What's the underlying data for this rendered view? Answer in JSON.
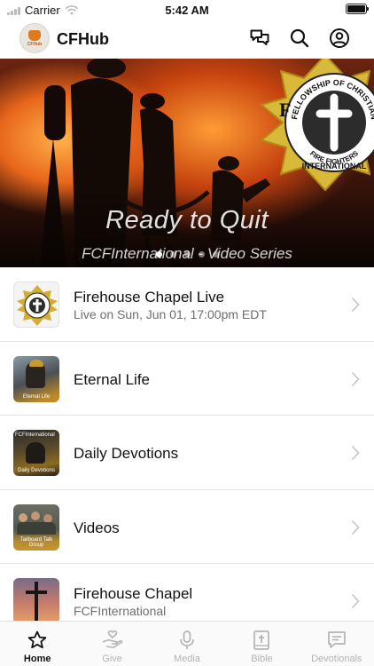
{
  "status_bar": {
    "carrier": "Carrier",
    "time": "5:42 AM"
  },
  "header": {
    "logo_text": "CFHub",
    "title": "CFHub",
    "icons": [
      "chat-icon",
      "search-icon",
      "profile-icon"
    ]
  },
  "hero": {
    "title": "Ready to Quit",
    "subtitle": "FCFInternational - Video Series",
    "badge_text": {
      "top": "FELLOWSHIP OF CHRISTIAN",
      "right": "FIRE FIGHTERS",
      "bottom": "INTERNATIONAL",
      "letter": "F"
    },
    "dots_total": 5,
    "active_dot": 1
  },
  "list": [
    {
      "title": "Firehouse Chapel Live",
      "subtitle": "Live on Sun, Jun 01, 17:00pm EDT",
      "thumb": "fcf-badge-thumb",
      "thumb_label": ""
    },
    {
      "title": "Eternal Life",
      "subtitle": "",
      "thumb": "firefighter-photo-thumb",
      "thumb_label": "Eternal Life"
    },
    {
      "title": "Daily Devotions",
      "subtitle": "",
      "thumb": "devotions-photo-thumb",
      "thumb_top_label": "FCFInternational",
      "thumb_label": "Daily Devotions"
    },
    {
      "title": "Videos",
      "subtitle": "",
      "thumb": "group-photo-thumb",
      "thumb_label": "Tailboard Talk Group"
    },
    {
      "title": "Firehouse Chapel",
      "subtitle": "FCFInternational",
      "thumb": "cross-sunset-thumb",
      "thumb_label": ""
    }
  ],
  "tabs": [
    {
      "label": "Home",
      "icon": "star-icon",
      "active": true
    },
    {
      "label": "Give",
      "icon": "give-hand-icon",
      "active": false
    },
    {
      "label": "Media",
      "icon": "microphone-icon",
      "active": false
    },
    {
      "label": "Bible",
      "icon": "bible-icon",
      "active": false
    },
    {
      "label": "Devotionals",
      "icon": "devotional-chat-icon",
      "active": false
    }
  ],
  "colors": {
    "accent": "#111111",
    "inactive_tab": "#b3b3b3",
    "logo_orange": "#e07a1f",
    "hero_fire": "#e8661b"
  }
}
